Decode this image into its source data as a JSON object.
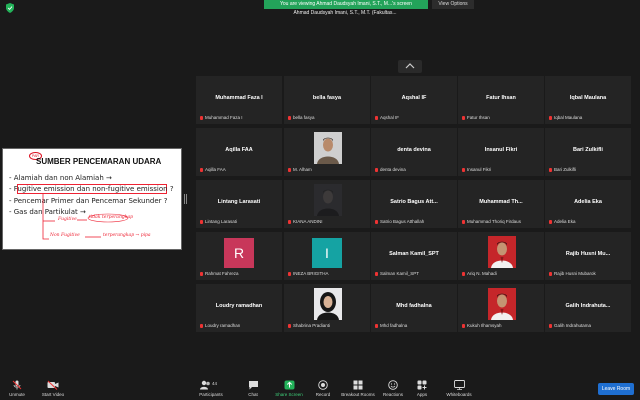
{
  "window": {
    "share_banner": "You are viewing Ahmad Daudsyah Imani, S.T., M...'s screen",
    "view_options": "View Options",
    "active_speaker": "Ahmad Daudsyah Imani, S.T., M.T. (Fakultas..."
  },
  "slide": {
    "badge": "PAR",
    "title": "SUMBER PENCEMARAN UDARA",
    "bullets": [
      "- Alamiah dan non Alamiah →",
      "- Fugitive emission dan non-fugitive emission ?",
      "- Pencemar Primer dan Pencemar Sekunder ?",
      "- Gas dan Partikulat →"
    ],
    "scribbles": [
      "Fugitive",
      "tidak terperangkap",
      "Non Fugitive",
      "terperangkap → pipa"
    ]
  },
  "participants": [
    {
      "name": "Muhammad Faza I",
      "label": "Muhammad Faza I",
      "type": "name"
    },
    {
      "name": "bella fasya",
      "label": "bella fasya",
      "type": "name"
    },
    {
      "name": "Aqshal IF",
      "label": "Aqshal IF",
      "type": "name"
    },
    {
      "name": "Fatur Ihsan",
      "label": "Fatur Ihsan",
      "type": "name"
    },
    {
      "name": "Iqbal Maulana",
      "label": "Iqbal Maulana",
      "type": "name"
    },
    {
      "name": "Aqilla FAA",
      "label": "Aqilla FAA",
      "type": "name"
    },
    {
      "name": "",
      "label": "M. Alham",
      "type": "photo"
    },
    {
      "name": "denta devina",
      "label": "denta devina",
      "type": "name"
    },
    {
      "name": "Insanul Fikri",
      "label": "Insanul Fikri",
      "type": "name"
    },
    {
      "name": "Bari Zulkifli",
      "label": "Bari Zulkifli",
      "type": "name"
    },
    {
      "name": "Lintang Larasati",
      "label": "Lintang Larasati",
      "type": "name"
    },
    {
      "name": "",
      "label": "KIANA ANDINI",
      "type": "photo-dark"
    },
    {
      "name": "Satrio Bagus Att...",
      "label": "Satrio Bagus Atthallah",
      "type": "name"
    },
    {
      "name": "Muhammad Th...",
      "label": "Muhammad Thoriq Firdaus",
      "type": "name"
    },
    {
      "name": "Adelia Eka",
      "label": "Adelia Eka",
      "type": "name"
    },
    {
      "name": "R",
      "label": "Rahmat Fahreza",
      "type": "letter",
      "color": "#c8375a"
    },
    {
      "name": "I",
      "label": "INEZA BRIGITHA",
      "type": "letter",
      "color": "#15a3a3"
    },
    {
      "name": "Salman Kamil_SPT",
      "label": "Salman Kamil_SPT",
      "type": "name"
    },
    {
      "name": "",
      "label": "Ariq N. Mahadi",
      "type": "photo-red"
    },
    {
      "name": "Rajib Husni Mu...",
      "label": "Rajib Husni Mubarok",
      "type": "name"
    },
    {
      "name": "Loudry ramadhan",
      "label": "Loudry ramadhan",
      "type": "name"
    },
    {
      "name": "",
      "label": "Shabrina Pradianti",
      "type": "photo-hijab"
    },
    {
      "name": "Mhd fadhalna",
      "label": "Mhd fadhalna",
      "type": "name"
    },
    {
      "name": "",
      "label": "Kukuh Ilhamsyah",
      "type": "photo-red"
    },
    {
      "name": "Galih Indrahuta...",
      "label": "Galih Indrahutama",
      "type": "name"
    }
  ],
  "toolbar": {
    "unmute": "Unmute",
    "start_video": "Start Video",
    "participants": "Participants",
    "participants_count": "44",
    "chat": "Chat",
    "share_screen": "Share Screen",
    "record": "Record",
    "breakout_rooms": "Breakout Rooms",
    "reactions": "Reactions",
    "apps": "Apps",
    "whiteboards": "Whiteboards",
    "leave": "Leave Room"
  },
  "colors": {
    "background": "#1a1a1a",
    "tile": "#242424",
    "share_green": "#23a35a",
    "leave_blue": "#1f6fd1",
    "muted_red": "#e33"
  }
}
